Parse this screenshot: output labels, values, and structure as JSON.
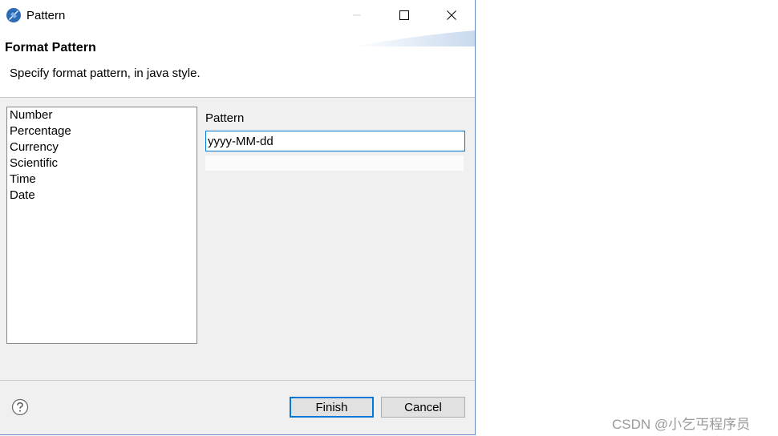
{
  "window": {
    "title": "Pattern",
    "controls": {
      "minimize": "minimize",
      "maximize": "maximize",
      "close": "close"
    }
  },
  "header": {
    "title": "Format Pattern",
    "description": "Specify format pattern, in java style."
  },
  "format_list": {
    "items": [
      "Number",
      "Percentage",
      "Currency",
      "Scientific",
      "Time",
      "Date"
    ]
  },
  "pattern": {
    "label": "Pattern",
    "value": "yyyy-MM-dd"
  },
  "buttons": {
    "finish": "Finish",
    "cancel": "Cancel"
  },
  "icons": {
    "app": "eclipse-app-icon",
    "help": "help-icon"
  },
  "colors": {
    "accent": "#0078d7",
    "window_border": "#6b8fc6",
    "dialog_bg": "#f0f0f0"
  },
  "watermark": "CSDN @小乞丐程序员"
}
